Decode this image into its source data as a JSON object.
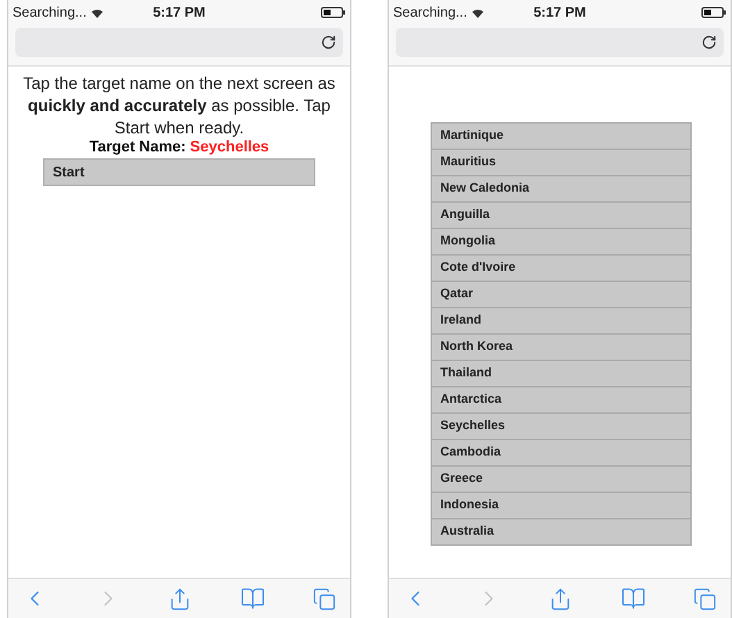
{
  "screens": [
    {
      "kind": "instructions",
      "status_bar": {
        "carrier": "Searching...",
        "time": "5:17 PM"
      },
      "toolbar": {
        "back_enabled": true,
        "forward_enabled": false
      },
      "instruction": "Tap the target name on the next screen as **quickly and accurately** as possible. Tap Start when ready.",
      "target_label": "Target Name:",
      "target_name": "Seychelles",
      "start_button": "Start"
    },
    {
      "kind": "list",
      "status_bar": {
        "carrier": "Searching...",
        "time": "5:17 PM"
      },
      "toolbar": {
        "back_enabled": true,
        "forward_enabled": false
      },
      "items": [
        "Martinique",
        "Mauritius",
        "New Caledonia",
        "Anguilla",
        "Mongolia",
        "Cote d'Ivoire",
        "Qatar",
        "Ireland",
        "North Korea",
        "Thailand",
        "Antarctica",
        "Seychelles",
        "Cambodia",
        "Greece",
        "Indonesia",
        "Australia"
      ]
    }
  ]
}
